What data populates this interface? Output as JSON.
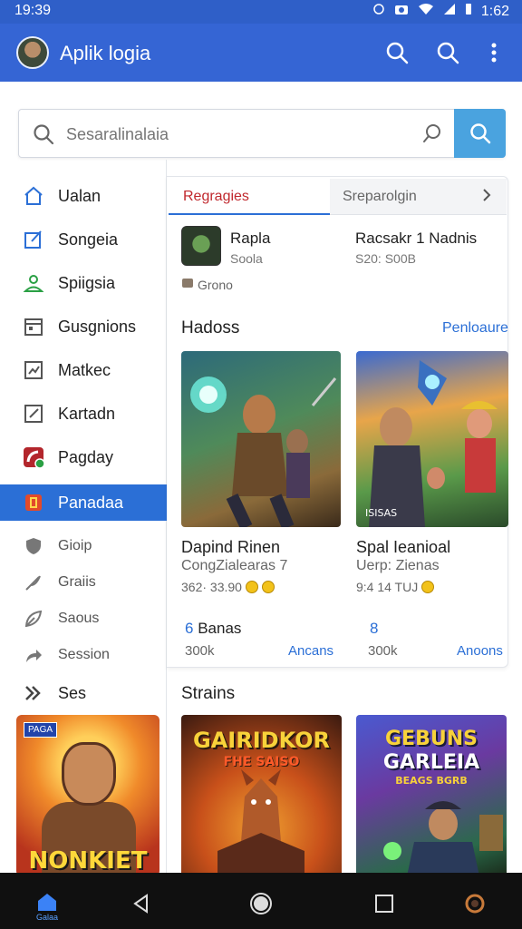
{
  "status": {
    "time": "19:39",
    "clock_right": "1:62"
  },
  "appbar": {
    "title": "Aplik logia"
  },
  "search": {
    "placeholder": "Sesaralinalaia"
  },
  "sidebar": {
    "items": [
      {
        "label": "Ualan",
        "icon": "home-icon"
      },
      {
        "label": "Songeia",
        "icon": "edit-box-icon"
      },
      {
        "label": "Spiigsia",
        "icon": "person-icon"
      },
      {
        "label": "Gusgnions",
        "icon": "calendar-icon"
      },
      {
        "label": "Matkec",
        "icon": "chart-box-icon"
      },
      {
        "label": "Kartadn",
        "icon": "pencil-box-icon"
      },
      {
        "label": "Pagday",
        "icon": "pay-card-icon"
      },
      {
        "label": "Panadaa",
        "icon": "gamepad-icon"
      }
    ],
    "small_items": [
      {
        "label": "Gioip",
        "icon": "shield-icon"
      },
      {
        "label": "Graiis",
        "icon": "feather-icon"
      },
      {
        "label": "Saous",
        "icon": "leaf-icon"
      },
      {
        "label": "Session",
        "icon": "share-arrow-icon"
      }
    ],
    "section": "Ses",
    "promo": {
      "badge": "PAGA",
      "word": "NONKIET"
    }
  },
  "card": {
    "tabs": [
      "Regragies",
      "Sreparolgin"
    ],
    "app": {
      "name": "Rapla",
      "sub": "Soola",
      "right_name": "Racsakr 1 Nadnis",
      "right_sub": "S20: S00B",
      "tag": "Grono"
    },
    "section_title": "Hadoss",
    "section_link": "Penloaure",
    "games": [
      {
        "name": "Dapind Rinen",
        "sub": "CongZialearas 7",
        "meta": "362· 33.90"
      },
      {
        "name": "Spal Ieanioal",
        "sub": "Uerp: Zienas",
        "meta": "9:4 14 TUJ",
        "overlay": "ISISAS"
      }
    ],
    "stats": [
      {
        "num": "6",
        "label": "Banas",
        "value": "300k",
        "link": "Ancans"
      },
      {
        "num": "8",
        "label": "",
        "value": "300k",
        "link": "Anoons"
      }
    ]
  },
  "strains": {
    "title": "Strains",
    "games": [
      {
        "line1": "GAIRIDKOR",
        "line2": "FHE SAISO"
      },
      {
        "line1": "GEBUNS",
        "line2": "GARLEIA",
        "line3": "BEAGS BGRB"
      }
    ]
  },
  "navbar": {
    "home_label": "Galaa"
  },
  "colors": {
    "appbar": "#3565d4",
    "accent": "#2b6fd6",
    "active": "#2b6fd6",
    "tab_active_text": "#c0282d"
  }
}
